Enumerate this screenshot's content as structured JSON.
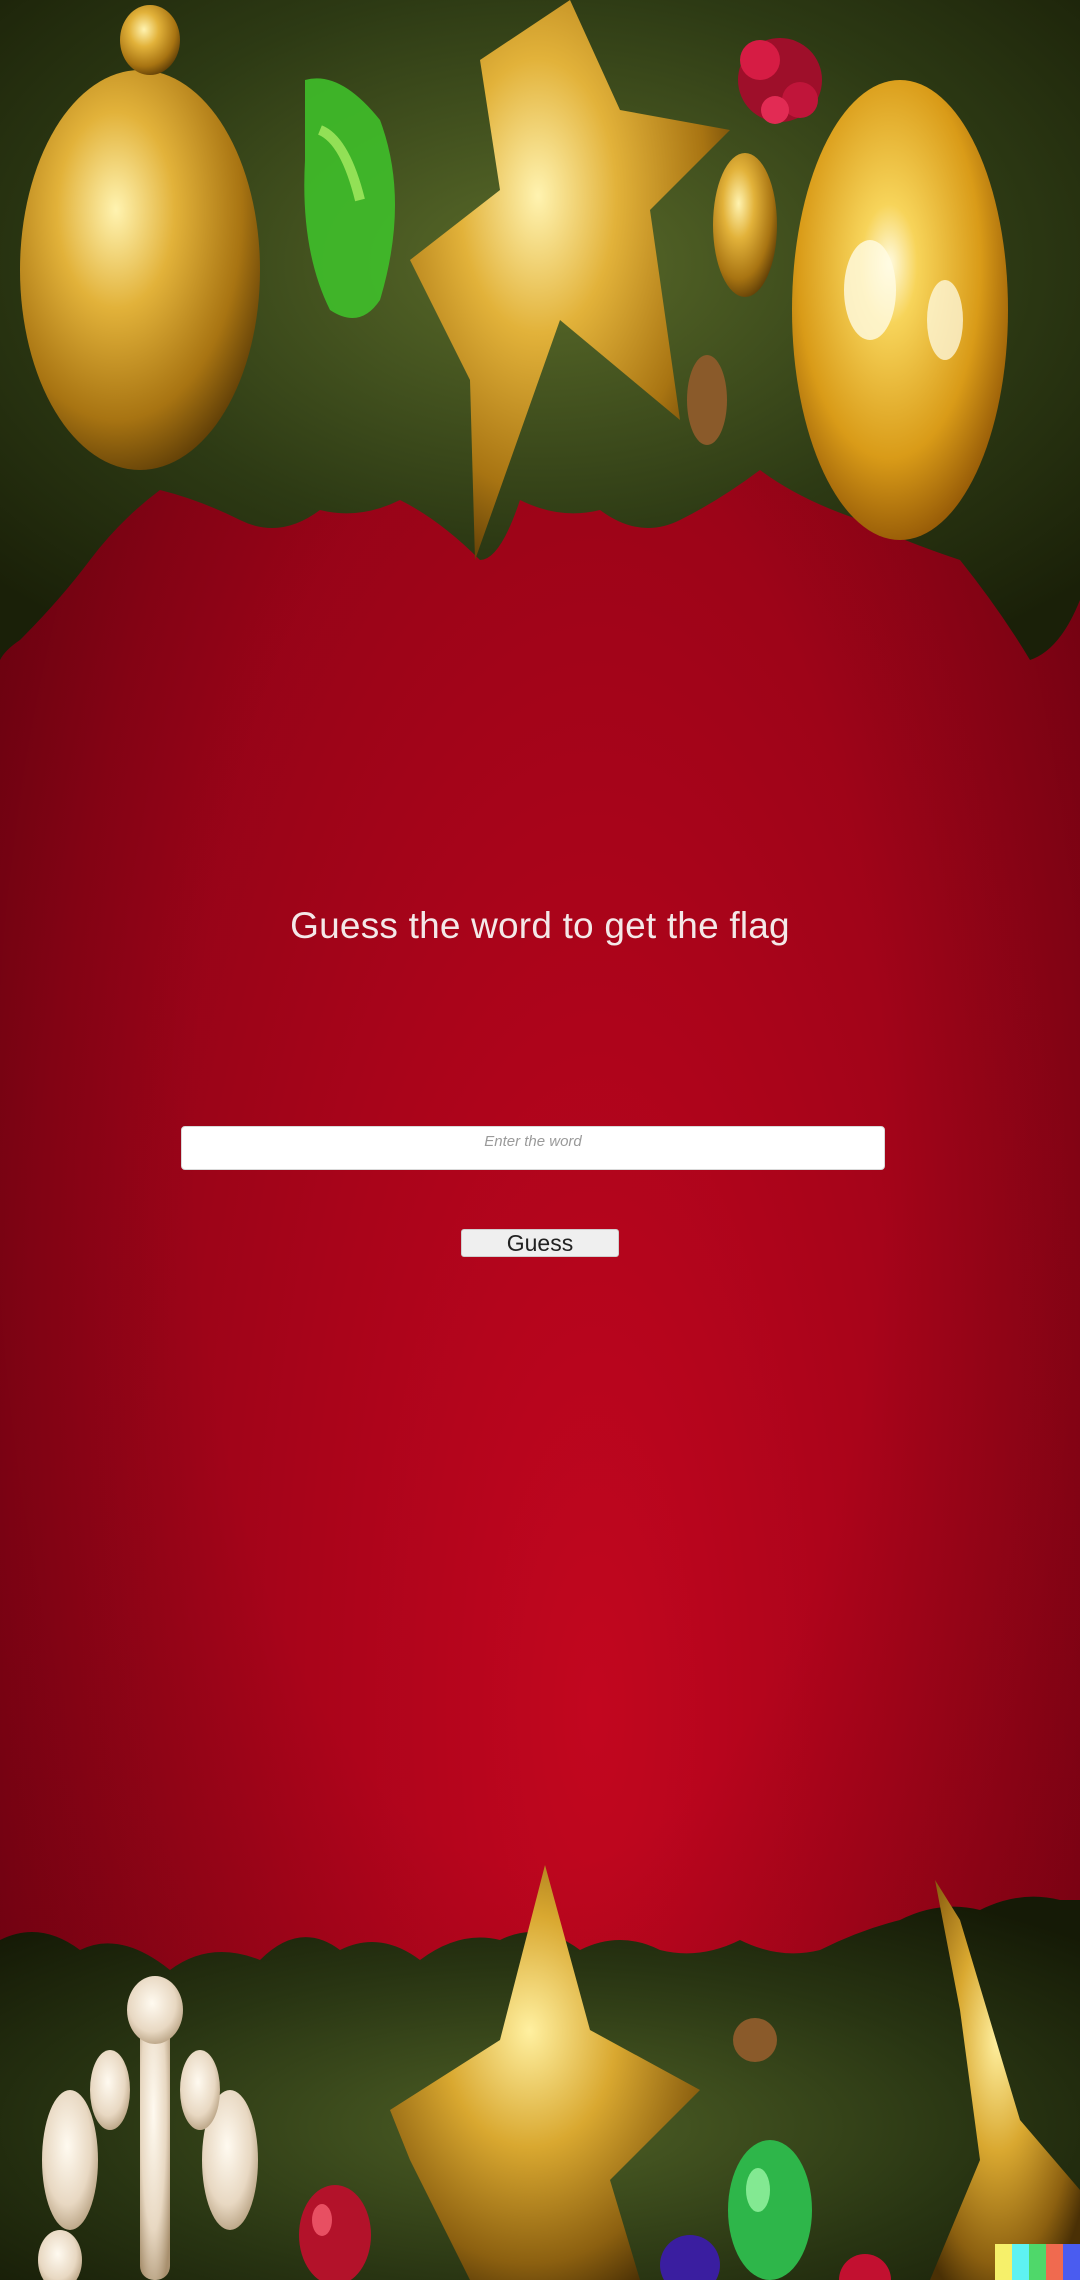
{
  "page": {
    "title": "Guess the word to get the flag"
  },
  "form": {
    "input_placeholder": "Enter the word",
    "input_value": "",
    "guess_label": "Guess"
  },
  "decor": {
    "top_garland": [
      "gold-ornament-icon",
      "green-ornament-icon",
      "gold-star-icon",
      "red-flower-icon",
      "gold-egg-ornament-icon",
      "gold-ball-ornament-icon"
    ],
    "bottom_garland": [
      "snowflake-ornament-icon",
      "red-ornament-icon",
      "gold-star-icon",
      "purple-ornament-icon",
      "green-ornament-icon",
      "gold-cone-ornament-icon"
    ],
    "swatch_colors": [
      "#f6f06a",
      "#5ef2f2",
      "#4fd86a",
      "#f06a4f",
      "#4a5cf0"
    ]
  },
  "colors": {
    "background": "#a9041a",
    "title_text": "#f4e8e8"
  }
}
